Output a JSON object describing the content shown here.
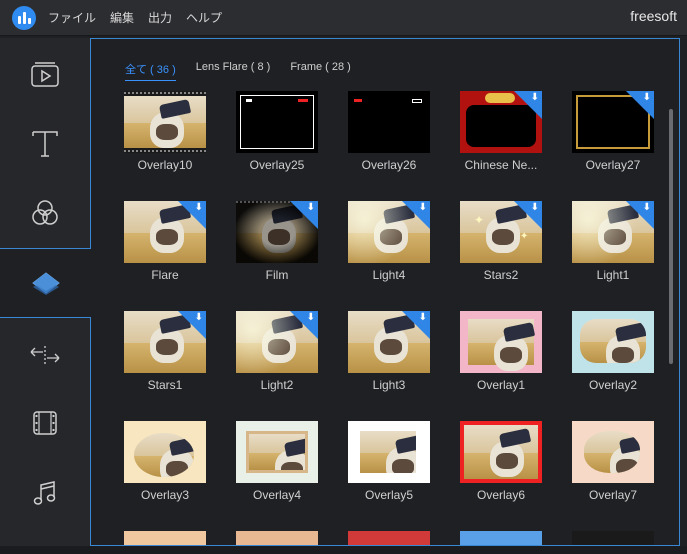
{
  "menubar": {
    "items": [
      "ファイル",
      "編集",
      "出力",
      "ヘルプ"
    ],
    "brand": "freesoft"
  },
  "sidebar": {
    "items": [
      {
        "name": "media",
        "icon": "play-box-icon"
      },
      {
        "name": "text",
        "icon": "text-t-icon"
      },
      {
        "name": "filters",
        "icon": "filter-circles-icon"
      },
      {
        "name": "overlays",
        "icon": "layers-diamond-icon",
        "active": true
      },
      {
        "name": "transitions",
        "icon": "transition-arrows-icon"
      },
      {
        "name": "elements",
        "icon": "film-strip-icon"
      },
      {
        "name": "music",
        "icon": "music-note-icon"
      }
    ]
  },
  "tabs": [
    {
      "label": "全て ( 36 )",
      "active": true
    },
    {
      "label": "Lens Flare ( 8 )",
      "active": false
    },
    {
      "label": "Frame ( 28 )",
      "active": false
    }
  ],
  "tiles": [
    {
      "label": "Overlay10",
      "style": "film-strip",
      "download": false
    },
    {
      "label": "Overlay25",
      "style": "black-frame",
      "download": false
    },
    {
      "label": "Overlay26",
      "style": "black-rec",
      "download": false
    },
    {
      "label": "Chinese Ne...",
      "style": "red-ornate",
      "download": true
    },
    {
      "label": "Overlay27",
      "style": "gold-frame",
      "download": true
    },
    {
      "label": "Flare",
      "style": "dog",
      "download": true
    },
    {
      "label": "Film",
      "style": "dark-vignette",
      "download": true
    },
    {
      "label": "Light4",
      "style": "dog-light",
      "download": true
    },
    {
      "label": "Stars2",
      "style": "dog-stars",
      "download": true
    },
    {
      "label": "Light1",
      "style": "dog-light",
      "download": true
    },
    {
      "label": "Stars1",
      "style": "dog",
      "download": true
    },
    {
      "label": "Light2",
      "style": "dog-light",
      "download": true
    },
    {
      "label": "Light3",
      "style": "dog",
      "download": true
    },
    {
      "label": "Overlay1",
      "style": "pink-frame",
      "download": false
    },
    {
      "label": "Overlay2",
      "style": "cloud-frame",
      "download": false
    },
    {
      "label": "Overlay3",
      "style": "cute-frame",
      "download": false
    },
    {
      "label": "Overlay4",
      "style": "photo-frame",
      "download": false
    },
    {
      "label": "Overlay5",
      "style": "white-frame",
      "download": false
    },
    {
      "label": "Overlay6",
      "style": "red-frame",
      "download": false
    },
    {
      "label": "Overlay7",
      "style": "peach-frame",
      "download": false
    }
  ],
  "colors": {
    "accent": "#3a92ff",
    "download_badge": "#2f86e6"
  }
}
